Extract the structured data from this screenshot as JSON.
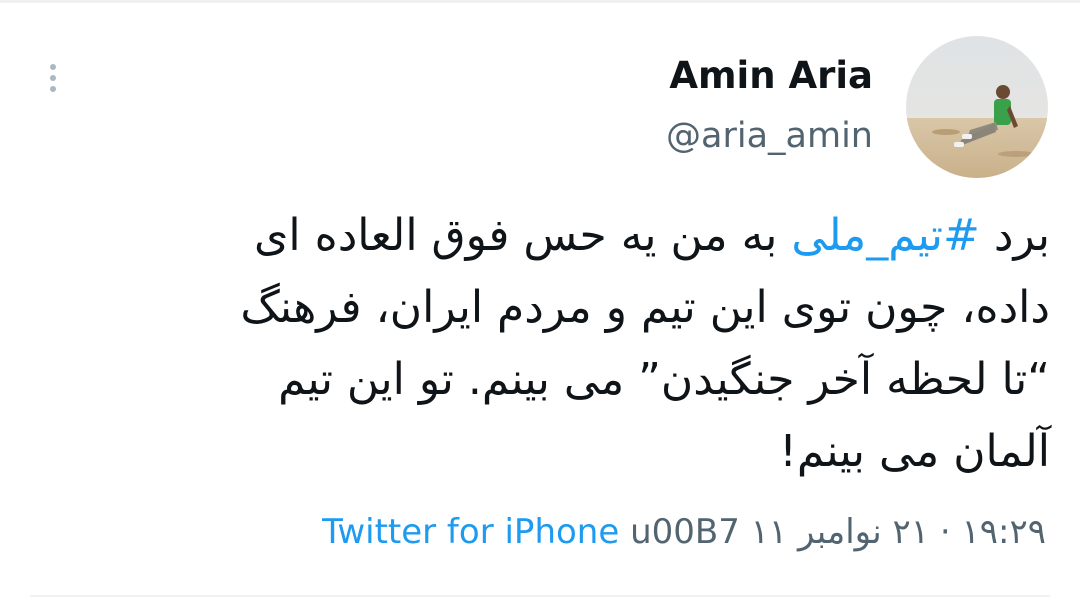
{
  "author": {
    "display_name": "Amin Aria",
    "handle": "@aria_amin"
  },
  "tweet": {
    "line1_prefix": "برد ",
    "hashtag": "#تیم_ملی",
    "line1_suffix": " به من یه حس فوق العاده ای",
    "line2": "داده، چون توی این تیم و مردم ایران، فرهنگ",
    "line3": "“تا لحظه آخر جنگیدن” می بینم. تو این تیم",
    "line4": "آلمان می بینم!"
  },
  "meta": {
    "source": "Twitter for iPhone",
    "separator": " u00B7 ",
    "date": "۲۱ نوامبر ۱۱",
    "dot": " · ",
    "time": "۱۹:۲۹"
  },
  "colors": {
    "link": "#1d9bf0",
    "secondary_text": "#536471",
    "primary_text": "#0f1419"
  },
  "icons": {
    "more": "vertical-ellipsis-icon"
  }
}
